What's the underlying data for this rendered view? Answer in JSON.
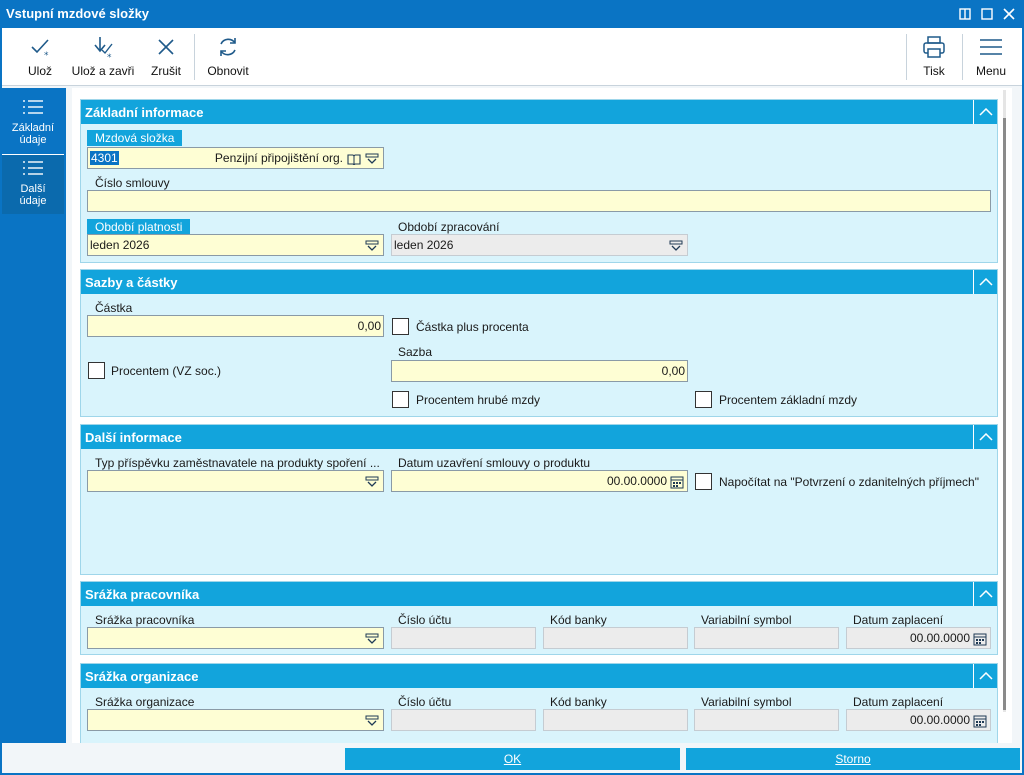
{
  "window": {
    "title": "Vstupní mzdové složky"
  },
  "toolbar": {
    "save": "Ulož",
    "save_close": "Ulož a zavři",
    "cancel": "Zrušit",
    "refresh": "Obnovit",
    "print": "Tisk",
    "menu": "Menu"
  },
  "nav": {
    "basic": "Základní údaje",
    "more": "Další údaje"
  },
  "basic_info": {
    "header": "Základní informace",
    "component_label": "Mzdová složka",
    "component_code": "4301",
    "component_name": "Penzijní připojištění org.",
    "contract_label": "Číslo smlouvy",
    "contract_value": "",
    "validity_label": "Období platnosti",
    "validity_value": "leden 2026",
    "processing_label": "Období zpracování",
    "processing_value": "leden 2026"
  },
  "rates": {
    "header": "Sazby a částky",
    "amount_label": "Částka",
    "amount_value": "0,00",
    "amount_plus_percent": "Částka plus procenta",
    "percent_vz": "Procentem (VZ soc.)",
    "rate_label": "Sazba",
    "rate_value": "0,00",
    "percent_gross": "Procentem hrubé mzdy",
    "percent_base": "Procentem základní mzdy"
  },
  "more_info": {
    "header": "Další informace",
    "type_label": "Typ příspěvku zaměstnavatele na produkty spoření ...",
    "type_value": "",
    "date_label": "Datum uzavření smlouvy o produktu",
    "date_value": "00.00.0000",
    "include_label": "Napočítat na \"Potvrzení o zdanitelných příjmech\""
  },
  "employee_deduction": {
    "header": "Srážka pracovníka",
    "deduction_label": "Srážka pracovníka",
    "account_label": "Číslo účtu",
    "bank_label": "Kód banky",
    "vs_label": "Variabilní symbol",
    "pay_date_label": "Datum zaplacení",
    "pay_date_value": "00.00.0000"
  },
  "org_deduction": {
    "header": "Srážka organizace",
    "deduction_label": "Srážka organizace",
    "account_label": "Číslo účtu",
    "bank_label": "Kód banky",
    "vs_label": "Variabilní symbol",
    "pay_date_label": "Datum zaplacení",
    "pay_date_value": "00.00.0000"
  },
  "buttons": {
    "ok": "OK",
    "cancel": "Storno"
  }
}
